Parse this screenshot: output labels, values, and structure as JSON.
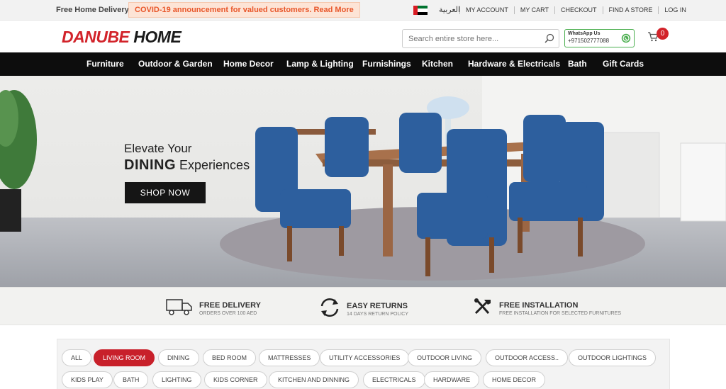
{
  "topbar": {
    "free_delivery": "Free Home Delivery",
    "announcement": "COVID-19 announcement for valued customers. Read More",
    "language": "العربية",
    "links": [
      "MY ACCOUNT",
      "MY CART",
      "CHECKOUT",
      "FIND A STORE",
      "LOG IN"
    ]
  },
  "header": {
    "logo_word1": "DANUBE",
    "logo_word2": "HOME",
    "search_placeholder": "Search entire store here...",
    "whatsapp_label": "WhatsApp Us",
    "whatsapp_number": "+971502777088",
    "cart_count": "0"
  },
  "nav": {
    "items": [
      "Furniture",
      "Outdoor & Garden",
      "Home Decor",
      "Lamp & Lighting",
      "Furnishings",
      "Kitchen",
      "Hardware & Electricals",
      "Bath",
      "Gift Cards"
    ]
  },
  "hero": {
    "line1": "Elevate Your",
    "line2_bold": "DINING",
    "line2_rest": "Experiences",
    "cta": "SHOP NOW"
  },
  "features": [
    {
      "title": "FREE DELIVERY",
      "subtitle": "ORDERS OVER 100 AED",
      "icon": "truck-icon"
    },
    {
      "title": "EASY RETURNS",
      "subtitle": "14 DAYS RETURN POLICY",
      "icon": "returns-icon"
    },
    {
      "title": "FREE INSTALLATION",
      "subtitle": "FREE INSTALLATION FOR SELECTED FURNITURES",
      "icon": "tools-icon"
    }
  ],
  "categories": {
    "active": "LIVING ROOM",
    "items": [
      "ALL",
      "LIVING ROOM",
      "DINING",
      "BED ROOM",
      "MATTRESSES",
      "UTILITY ACCESSORIES",
      "OUTDOOR LIVING",
      "OUTDOOR ACCESS..",
      "OUTDOOR LIGHTINGS",
      "KIDS PLAY",
      "BATH",
      "LIGHTING",
      "KIDS CORNER",
      "KITCHEN AND DINNING",
      "ELECTRICALS",
      "HARDWARE",
      "HOME DECOR"
    ]
  },
  "colors": {
    "brand_red": "#d2232a",
    "nav_bg": "#0d0d0d",
    "whatsapp_green": "#4caf50",
    "chair_blue": "#2d5f9e"
  }
}
